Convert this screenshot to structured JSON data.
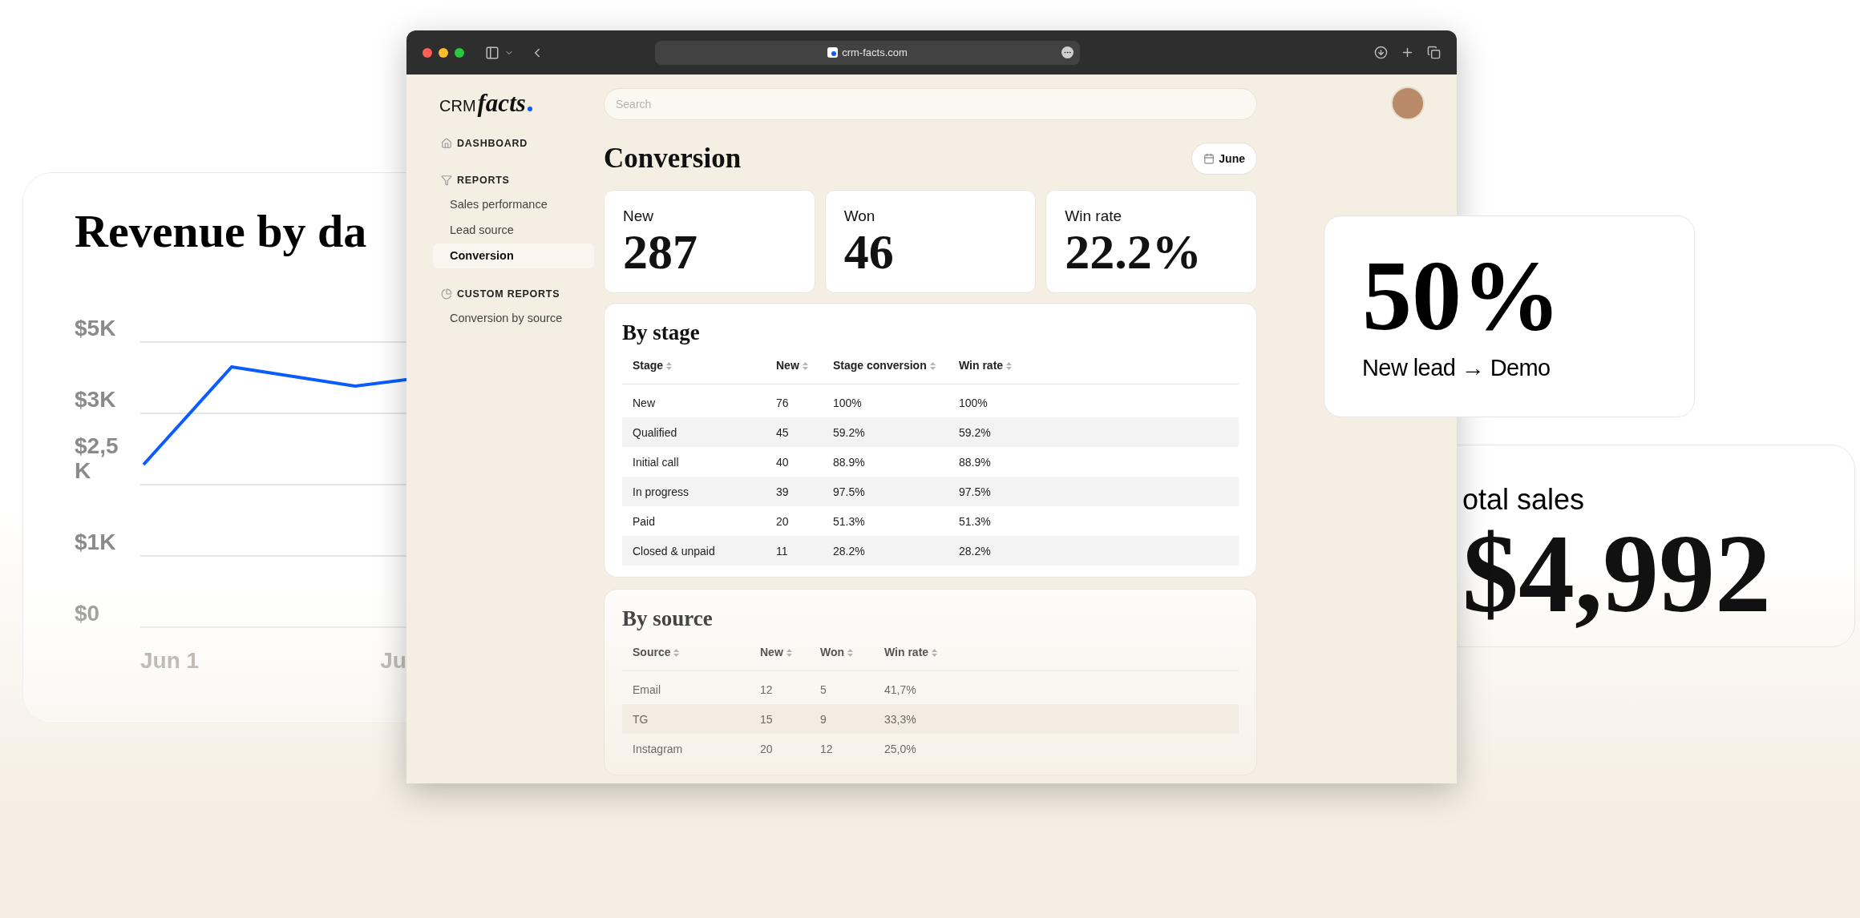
{
  "revenue_card": {
    "title": "Revenue by da",
    "y_labels": [
      "$5K",
      "$3K",
      "$2,5K",
      "$1K",
      "$0"
    ],
    "x_labels": [
      "Jun 1",
      "Ju"
    ]
  },
  "browser": {
    "url": "crm-facts.com"
  },
  "app": {
    "logo": {
      "prefix": "CRM",
      "word": "facts"
    },
    "search": {
      "placeholder": "Search"
    },
    "nav": [
      {
        "label": "DASHBOARD"
      },
      {
        "label": "REPORTS",
        "children": [
          {
            "label": "Sales performance",
            "selected": false
          },
          {
            "label": "Lead source",
            "selected": false
          },
          {
            "label": "Conversion",
            "selected": true
          }
        ]
      },
      {
        "label": "CUSTOM REPORTS",
        "children": [
          {
            "label": "Conversion by source",
            "selected": false
          }
        ]
      }
    ],
    "title": "Conversion",
    "period_button": "June",
    "stats": [
      {
        "label": "New",
        "value": "287"
      },
      {
        "label": "Won",
        "value": "46"
      },
      {
        "label": "Win rate",
        "value": "22.2%"
      }
    ],
    "by_stage": {
      "title": "By stage",
      "columns": [
        "Stage",
        "New",
        "Stage conversion",
        "Win rate"
      ],
      "rows": [
        [
          "New",
          "76",
          "100%",
          "100%"
        ],
        [
          "Qualified",
          "45",
          "59.2%",
          "59.2%"
        ],
        [
          "Initial call",
          "40",
          "88.9%",
          "88.9%"
        ],
        [
          "In progress",
          "39",
          "97.5%",
          "97.5%"
        ],
        [
          "Paid",
          "20",
          "51.3%",
          "51.3%"
        ],
        [
          "Closed & unpaid",
          "11",
          "28.2%",
          "28.2%"
        ]
      ]
    },
    "by_source": {
      "title": "By source",
      "columns": [
        "Source",
        "New",
        "Won",
        "Win rate"
      ],
      "rows": [
        [
          "Email",
          "12",
          "5",
          "41,7%"
        ],
        [
          "TG",
          "15",
          "9",
          "33,3%"
        ],
        [
          "Instagram",
          "20",
          "12",
          "25,0%"
        ]
      ]
    }
  },
  "conversion_card": {
    "value": "50%",
    "label": "New lead → Demo"
  },
  "sales_card": {
    "label": "otal sales",
    "value": "$4,992"
  }
}
